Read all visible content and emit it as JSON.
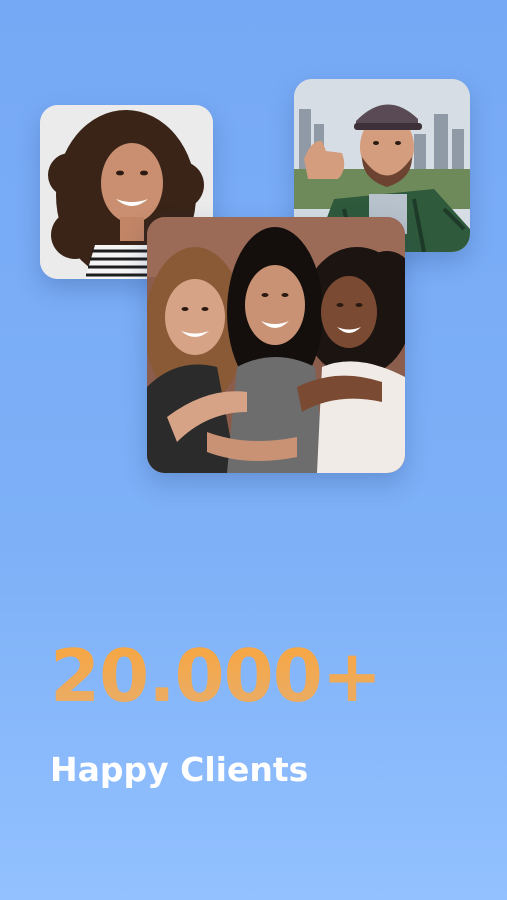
{
  "photos": {
    "woman": {
      "alt": "smiling woman with curly hair"
    },
    "man": {
      "alt": "man giving thumbs up"
    },
    "group": {
      "alt": "three smiling women"
    }
  },
  "stats": {
    "number": "20.000+",
    "label": "Happy Clients"
  },
  "colors": {
    "background_top": "#76a9f5",
    "background_bottom": "#93c1ff",
    "accent": "#f1a54a",
    "label": "#ffffff"
  }
}
